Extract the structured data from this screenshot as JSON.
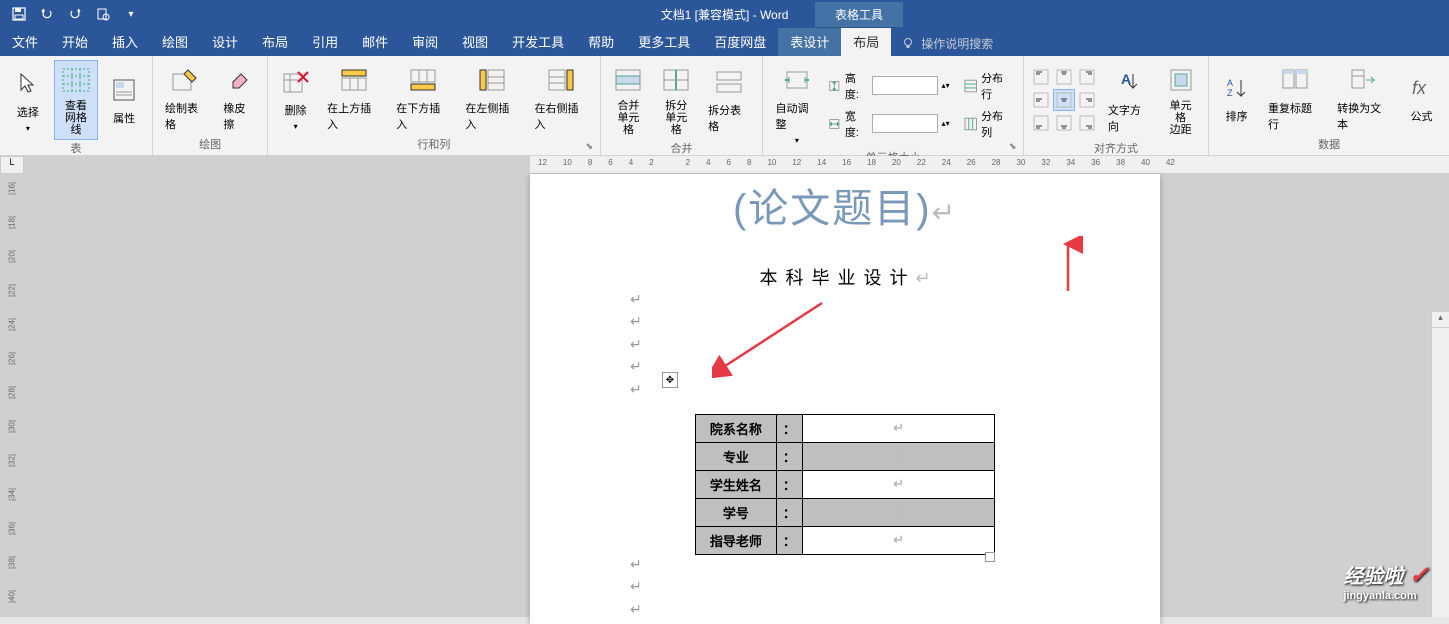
{
  "titlebar": {
    "title": "文档1 [兼容模式] - Word",
    "context_title": "表格工具"
  },
  "tabs": {
    "file": "文件",
    "home": "开始",
    "insert": "插入",
    "draw": "绘图",
    "design": "设计",
    "layout": "布局",
    "references": "引用",
    "mail": "邮件",
    "review": "审阅",
    "view": "视图",
    "developer": "开发工具",
    "help": "帮助",
    "more_tools": "更多工具",
    "baidu": "百度网盘",
    "table_design": "表设计",
    "table_layout": "布局",
    "tell_me": "操作说明搜索"
  },
  "ribbon": {
    "table_group": {
      "label": "表",
      "select": "选择",
      "view_gridlines": "查看\n网格线",
      "properties": "属性"
    },
    "draw_group": {
      "label": "绘图",
      "draw_table": "绘制表格",
      "eraser": "橡皮擦"
    },
    "rows_cols_group": {
      "label": "行和列",
      "delete": "删除",
      "insert_above": "在上方插入",
      "insert_below": "在下方插入",
      "insert_left": "在左侧插入",
      "insert_right": "在右侧插入"
    },
    "merge_group": {
      "label": "合并",
      "merge_cells": "合并\n单元格",
      "split_cells": "拆分\n单元格",
      "split_table": "拆分表格"
    },
    "cell_size_group": {
      "label": "单元格大小",
      "autofit": "自动调整",
      "height_label": "高度:",
      "width_label": "宽度:",
      "height_value": "",
      "width_value": "",
      "distribute_rows": "分布行",
      "distribute_cols": "分布列"
    },
    "alignment_group": {
      "label": "对齐方式",
      "text_direction": "文字方向",
      "cell_margins": "单元格\n边距"
    },
    "data_group": {
      "label": "数据",
      "sort": "排序",
      "repeat_header": "重复标题行",
      "convert_text": "转换为文本",
      "formula": "公式"
    }
  },
  "ruler_h": [
    "12",
    "10",
    "8",
    "6",
    "4",
    "2",
    "",
    "2",
    "4",
    "6",
    "8",
    "10",
    "12",
    "14",
    "16",
    "18",
    "20",
    "22",
    "24",
    "26",
    "28",
    "30",
    "32",
    "34",
    "36",
    "38",
    "40",
    "42"
  ],
  "ruler_v": [
    "|16|",
    "|18|",
    "|20|",
    "|22|",
    "|24|",
    "|26|",
    "|28|",
    "|30|",
    "|32|",
    "|34|",
    "|36|",
    "|38|",
    "|40|"
  ],
  "document": {
    "title": "(论文题目)",
    "subtitle": "本科毕业设计",
    "para_mark": "↵",
    "enter_mark": "↵",
    "table": {
      "rows": [
        {
          "label": "院系名称",
          "colon": "：",
          "value": ""
        },
        {
          "label": "专业",
          "colon": "：",
          "value": ""
        },
        {
          "label": "学生姓名",
          "colon": "：",
          "value": ""
        },
        {
          "label": "学号",
          "colon": "：",
          "value": ""
        },
        {
          "label": "指导老师",
          "colon": "：",
          "value": ""
        }
      ]
    }
  },
  "watermark": {
    "text": "经验啦",
    "url": "jingyanla.com",
    "check": "✓"
  }
}
